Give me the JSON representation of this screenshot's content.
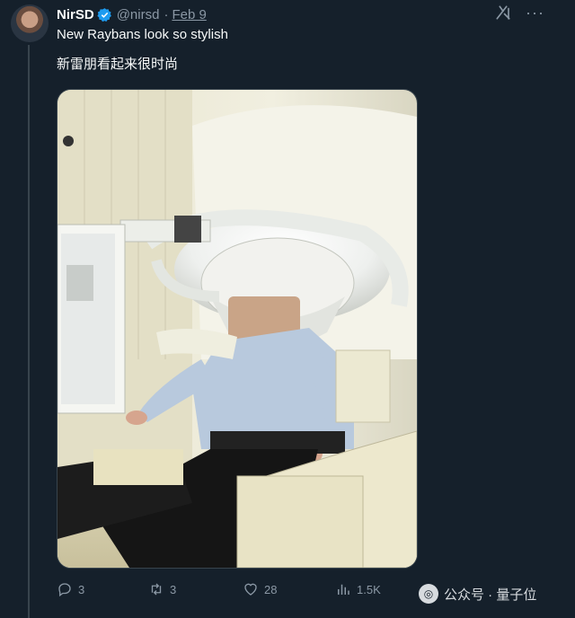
{
  "tweet": {
    "author_name": "NirSD",
    "handle": "@nirsd",
    "separator": "·",
    "date": "Feb 9",
    "text": "New Raybans look so stylish",
    "translation": "新雷朋看起来很时尚",
    "more_label": "···"
  },
  "actions": {
    "replies": "3",
    "retweets": "3",
    "likes": "28",
    "views": "1.5K"
  },
  "watermark": {
    "text": "公众号 · 量子位"
  },
  "colors": {
    "background": "#15202b",
    "text": "#f7f9f9",
    "secondary": "#8b98a5",
    "verified": "#1d9bf0"
  }
}
